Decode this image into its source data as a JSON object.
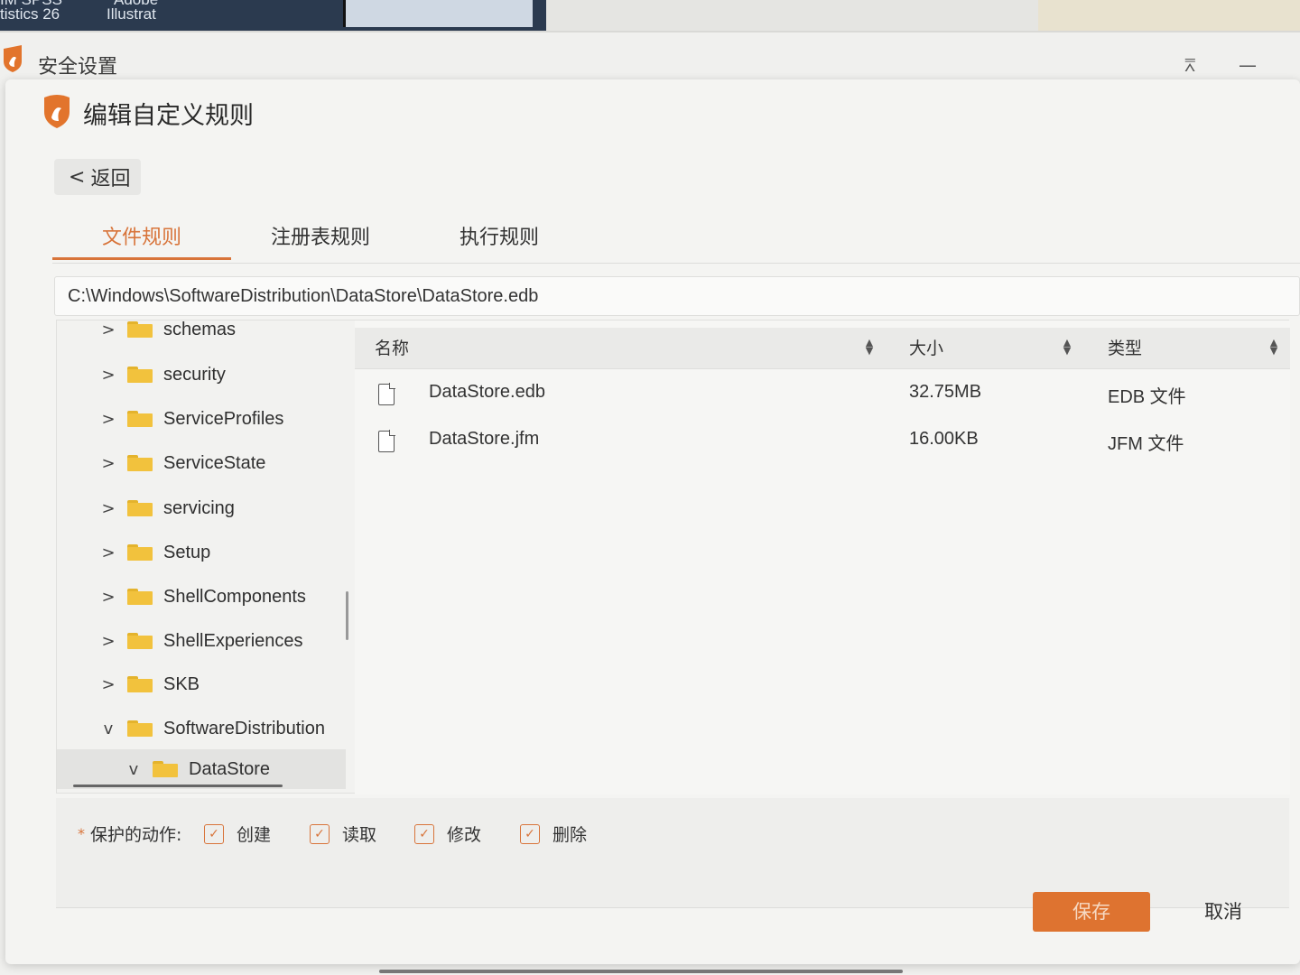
{
  "desktop": {
    "icon1_line1": "IM SPSS",
    "icon1_line2": "tistics 26",
    "icon2_line1": "Adobe",
    "icon2_line2": "Illustrat"
  },
  "window": {
    "title": "安全设置",
    "controls": {
      "menu": "⩞",
      "minimize": "—"
    }
  },
  "dialog": {
    "title": "编辑自定义规则",
    "back_label": "返回",
    "back_chevron": "<"
  },
  "tabs": [
    {
      "label": "文件规则",
      "active": true
    },
    {
      "label": "注册表规则",
      "active": false
    },
    {
      "label": "执行规则",
      "active": false
    }
  ],
  "path": "C:\\Windows\\SoftwareDistribution\\DataStore\\DataStore.edb",
  "tree": [
    {
      "label": "schemas",
      "chevron": ">"
    },
    {
      "label": "security",
      "chevron": ">"
    },
    {
      "label": "ServiceProfiles",
      "chevron": ">"
    },
    {
      "label": "ServiceState",
      "chevron": ">"
    },
    {
      "label": "servicing",
      "chevron": ">"
    },
    {
      "label": "Setup",
      "chevron": ">"
    },
    {
      "label": "ShellComponents",
      "chevron": ">"
    },
    {
      "label": "ShellExperiences",
      "chevron": ">"
    },
    {
      "label": "SKB",
      "chevron": ">"
    },
    {
      "label": "SoftwareDistribution",
      "chevron": "v"
    },
    {
      "label": "DataStore",
      "chevron": "v",
      "selected": true
    }
  ],
  "file_table": {
    "columns": [
      "名称",
      "大小",
      "类型"
    ],
    "rows": [
      {
        "name": "DataStore.edb",
        "size": "32.75MB",
        "type": "EDB 文件"
      },
      {
        "name": "DataStore.jfm",
        "size": "16.00KB",
        "type": "JFM 文件"
      }
    ]
  },
  "actions": {
    "required_mark": "*",
    "label": "保护的动作:",
    "items": [
      {
        "label": "创建",
        "checked": true
      },
      {
        "label": "读取",
        "checked": true
      },
      {
        "label": "修改",
        "checked": true
      },
      {
        "label": "删除",
        "checked": true
      }
    ]
  },
  "buttons": {
    "save": "保存",
    "cancel": "取消"
  },
  "colors": {
    "accent": "#de7330",
    "folder": "#f2c23d"
  }
}
